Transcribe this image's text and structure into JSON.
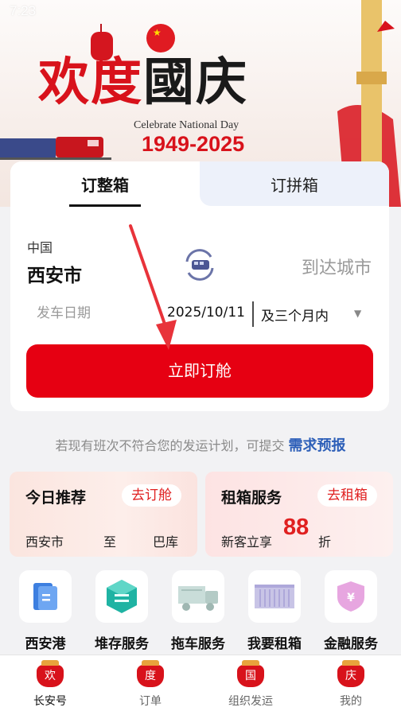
{
  "status_bar": {
    "time": "7:23"
  },
  "banner": {
    "title_chars": [
      "欢",
      "度",
      "國",
      "庆"
    ],
    "subtitle": "Celebrate National Day",
    "years": "1949-2025"
  },
  "booking": {
    "tabs": [
      {
        "label": "订整箱",
        "active": true
      },
      {
        "label": "订拼箱",
        "active": false
      }
    ],
    "origin_country": "中国",
    "origin_city": "西安市",
    "dest_placeholder": "到达城市",
    "date_label": "发车日期",
    "date_value": "2025/10/11",
    "range_value": "及三个月内",
    "submit_label": "立即订舱"
  },
  "notice": {
    "text": "若现有班次不符合您的发运计划，可提交",
    "link": "需求预报"
  },
  "promos": {
    "recommend": {
      "title": "今日推荐",
      "button": "去订舱",
      "from": "西安市",
      "to_word": "至",
      "dest": "巴库"
    },
    "rental": {
      "title": "租箱服务",
      "button": "去租箱",
      "prefix": "新客立享",
      "discount": "88",
      "unit": "折"
    }
  },
  "services": [
    {
      "label": "西安港",
      "icon": "port-icon"
    },
    {
      "label": "堆存服务",
      "icon": "storage-icon"
    },
    {
      "label": "拖车服务",
      "icon": "truck-icon"
    },
    {
      "label": "我要租箱",
      "icon": "container-icon"
    },
    {
      "label": "金融服务",
      "icon": "finance-icon"
    }
  ],
  "nav": [
    {
      "label": "长安号",
      "icon_char": "欢",
      "active": true
    },
    {
      "label": "订单",
      "icon_char": "度",
      "active": false
    },
    {
      "label": "组织发运",
      "icon_char": "国",
      "active": false
    },
    {
      "label": "我的",
      "icon_char": "庆",
      "active": false
    }
  ],
  "colors": {
    "primary_red": "#e60012",
    "link_blue": "#2d5fb8",
    "tab_inactive_bg": "#edf1fa"
  }
}
